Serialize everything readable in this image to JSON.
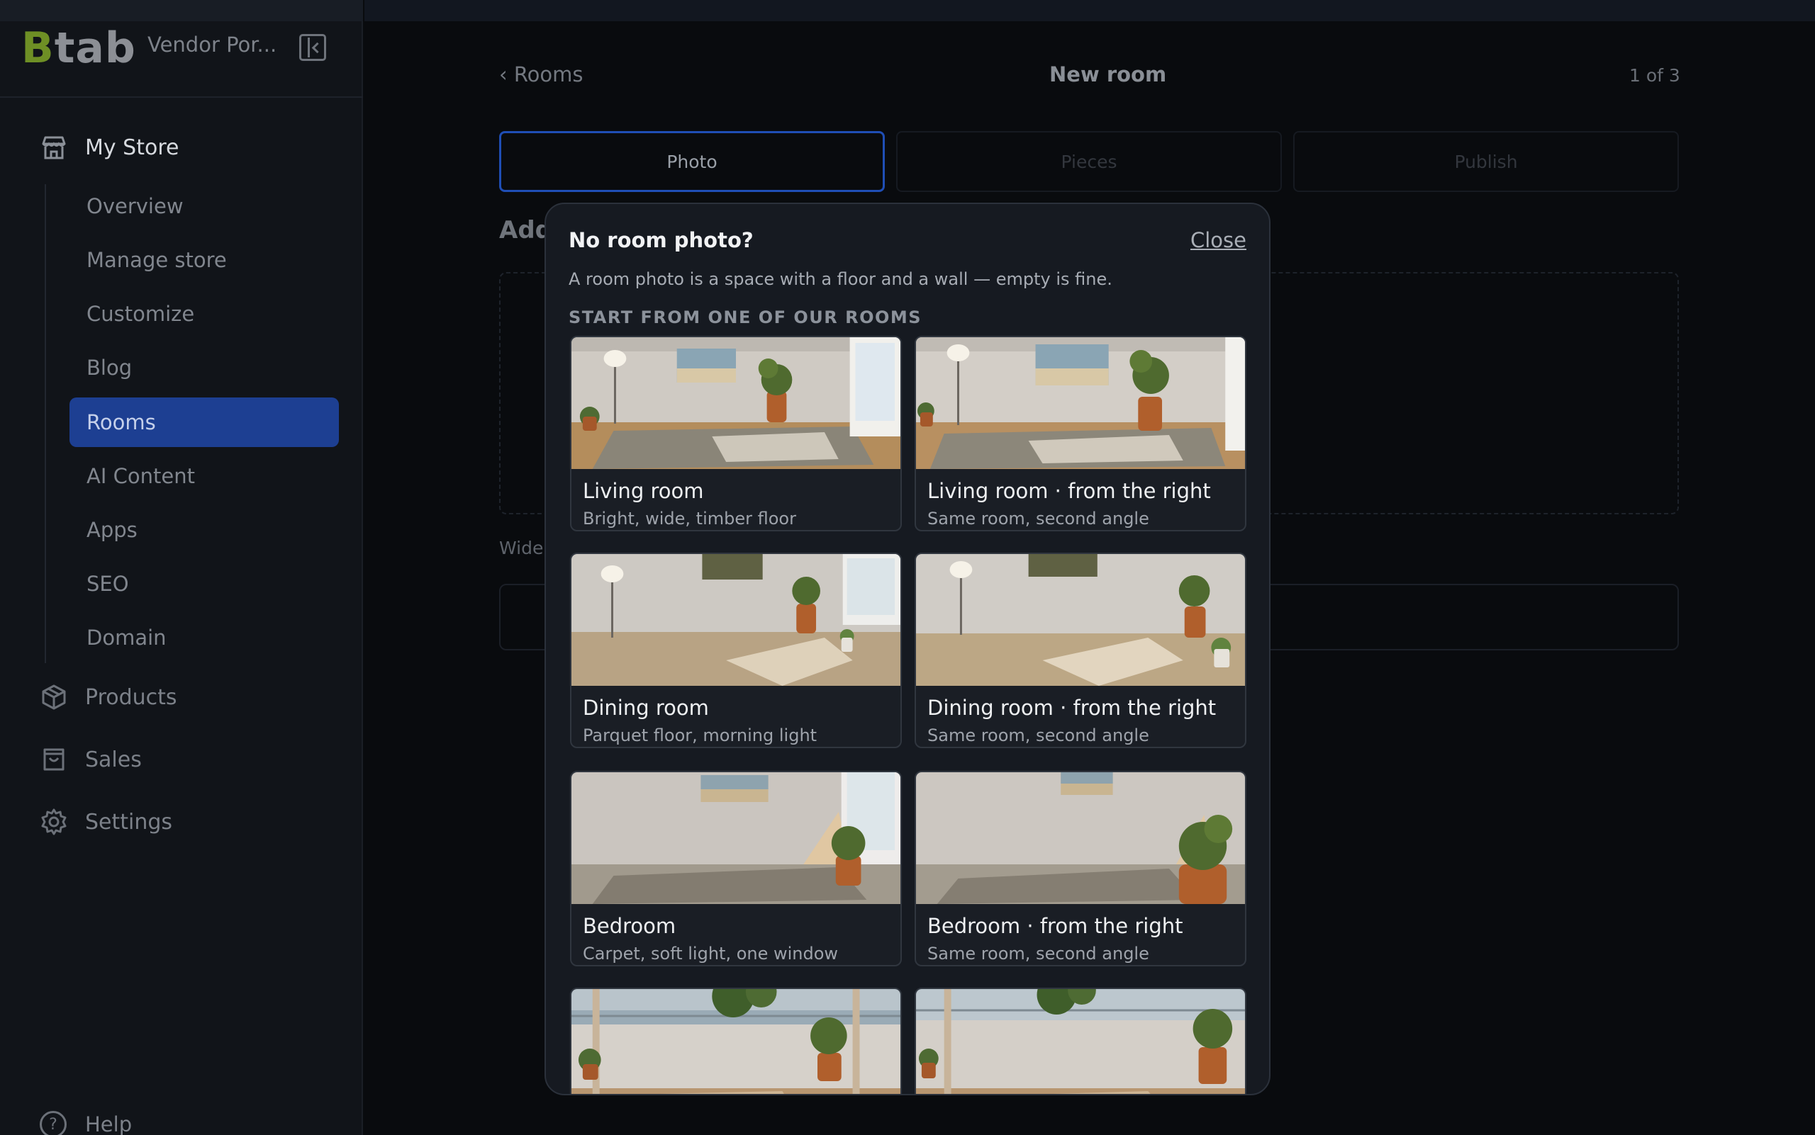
{
  "app": {
    "brand": "Btab",
    "brand_initial": "B",
    "brand_rest": "tab",
    "store_name": "Vendor Por..."
  },
  "sidebar": {
    "my_store": "My Store",
    "subnav": [
      "Overview",
      "Manage store",
      "Customize",
      "Blog",
      "Rooms",
      "AI Content",
      "Apps",
      "SEO",
      "Domain"
    ],
    "active_item": "Rooms",
    "products": "Products",
    "sales": "Sales",
    "settings": "Settings",
    "help": "Help"
  },
  "page": {
    "back_label": "‹ Rooms",
    "title": "New room",
    "step_count": "1 of 3",
    "steps": [
      "Photo",
      "Pieces",
      "Publish"
    ],
    "heading_partial": "Add",
    "hint_partial": "Wide"
  },
  "modal": {
    "title": "No room photo?",
    "close_label": "Close",
    "description": "A room photo is a space with a floor and a wall — empty is fine.",
    "section_label": "START FROM ONE OF OUR ROOMS",
    "rooms": [
      {
        "name": "Living room",
        "subtitle": "Bright, wide, timber floor"
      },
      {
        "name": "Living room · from the right",
        "subtitle": "Same room, second angle"
      },
      {
        "name": "Dining room",
        "subtitle": "Parquet floor, morning light"
      },
      {
        "name": "Dining room · from the right",
        "subtitle": "Same room, second angle"
      },
      {
        "name": "Bedroom",
        "subtitle": "Carpet, soft light, one window"
      },
      {
        "name": "Bedroom · from the right",
        "subtitle": "Same room, second angle"
      },
      {
        "name": "",
        "subtitle": ""
      },
      {
        "name": "",
        "subtitle": ""
      }
    ]
  },
  "colors": {
    "accent": "#1f4eb5",
    "active_nav": "#1d3f92",
    "brand_green": "#6e8f25",
    "background": "#090b0e"
  }
}
